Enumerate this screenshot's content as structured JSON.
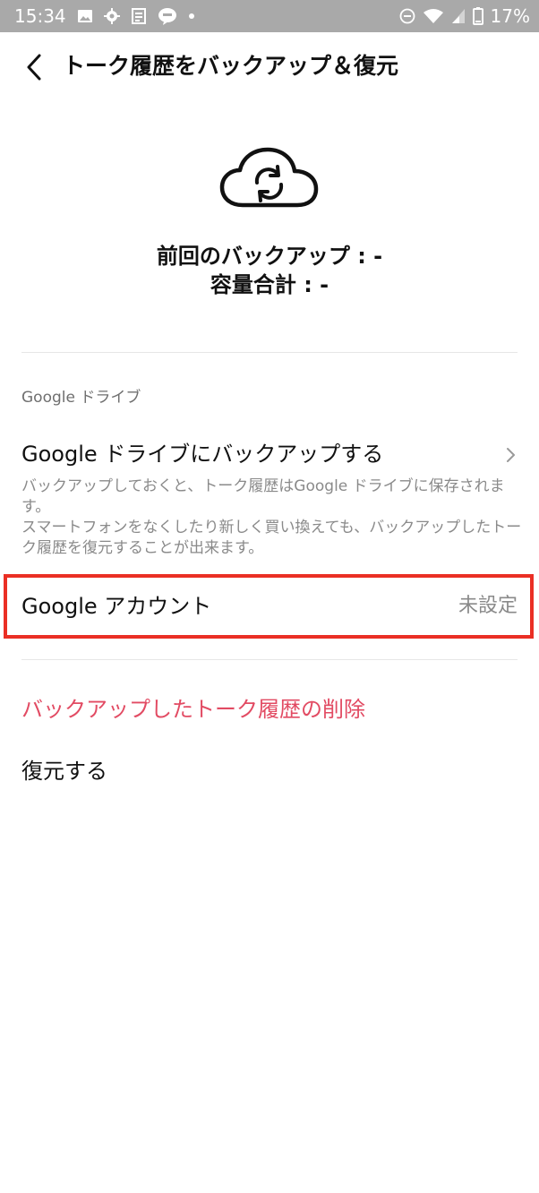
{
  "status_bar": {
    "time": "15:34",
    "battery": "17%",
    "icons_left": [
      "image-icon",
      "settings-icon",
      "news-icon",
      "line-icon",
      "dot-icon"
    ],
    "icons_right": [
      "do-not-disturb-icon",
      "wifi-icon",
      "signal-icon",
      "battery-icon"
    ]
  },
  "header": {
    "back_icon": "chevron-left-icon",
    "title": "トーク履歴をバックアップ＆復元"
  },
  "backup_summary": {
    "icon": "cloud-sync-icon",
    "last_backup": "前回のバックアップ : -",
    "total_size": "容量合計 : -"
  },
  "google_drive_section": {
    "label": "Google ドライブ",
    "backup_row": {
      "title": "Google ドライブにバックアップする",
      "description": "バックアップしておくと、トーク履歴はGoogle ドライブに保存されます。\nスマートフォンをなくしたり新しく買い換えても、バックアップしたトーク履歴を復元することが出来ます。",
      "chevron_icon": "chevron-right-icon"
    },
    "account_row": {
      "label": "Google アカウント",
      "value": "未設定"
    }
  },
  "actions": {
    "delete_label": "バックアップしたトーク履歴の削除",
    "restore_label": "復元する"
  },
  "colors": {
    "status_bar_bg": "#a9a9a9",
    "highlight_border": "#ea2f24",
    "delete_text": "#e24b63",
    "secondary_text": "#8a8a8a"
  }
}
